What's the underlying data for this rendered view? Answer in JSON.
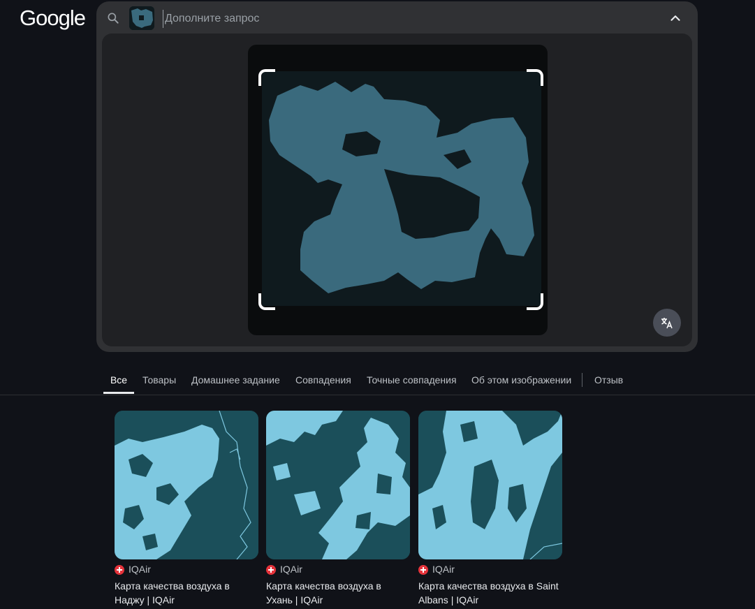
{
  "header": {
    "logo": "Google"
  },
  "search": {
    "placeholder": "Дополните запрос",
    "value": ""
  },
  "tabs": [
    {
      "label": "Все",
      "active": true
    },
    {
      "label": "Товары",
      "active": false
    },
    {
      "label": "Домашнее задание",
      "active": false
    },
    {
      "label": "Совпадения",
      "active": false
    },
    {
      "label": "Точные совпадения",
      "active": false
    },
    {
      "label": "Об этом изображении",
      "active": false
    },
    {
      "label": "Отзыв",
      "active": false
    }
  ],
  "results": [
    {
      "source": "IQAir",
      "title": "Карта качества воздуха в Наджу | IQAir"
    },
    {
      "source": "IQAir",
      "title": "Карта качества воздуха в Ухань | IQAir"
    },
    {
      "source": "IQAir",
      "title": "Карта качества воздуха в Saint Albans | IQAir"
    }
  ],
  "colors": {
    "background": "#101218",
    "panel": "#303134",
    "map_land": "#1b4f5a",
    "map_water": "#7ec8e0",
    "query_shape": "#3a6a7d",
    "favicon": "#e5333b"
  },
  "icons": [
    "search-icon",
    "chevron-up-icon",
    "translate-icon",
    "iqair-favicon"
  ]
}
